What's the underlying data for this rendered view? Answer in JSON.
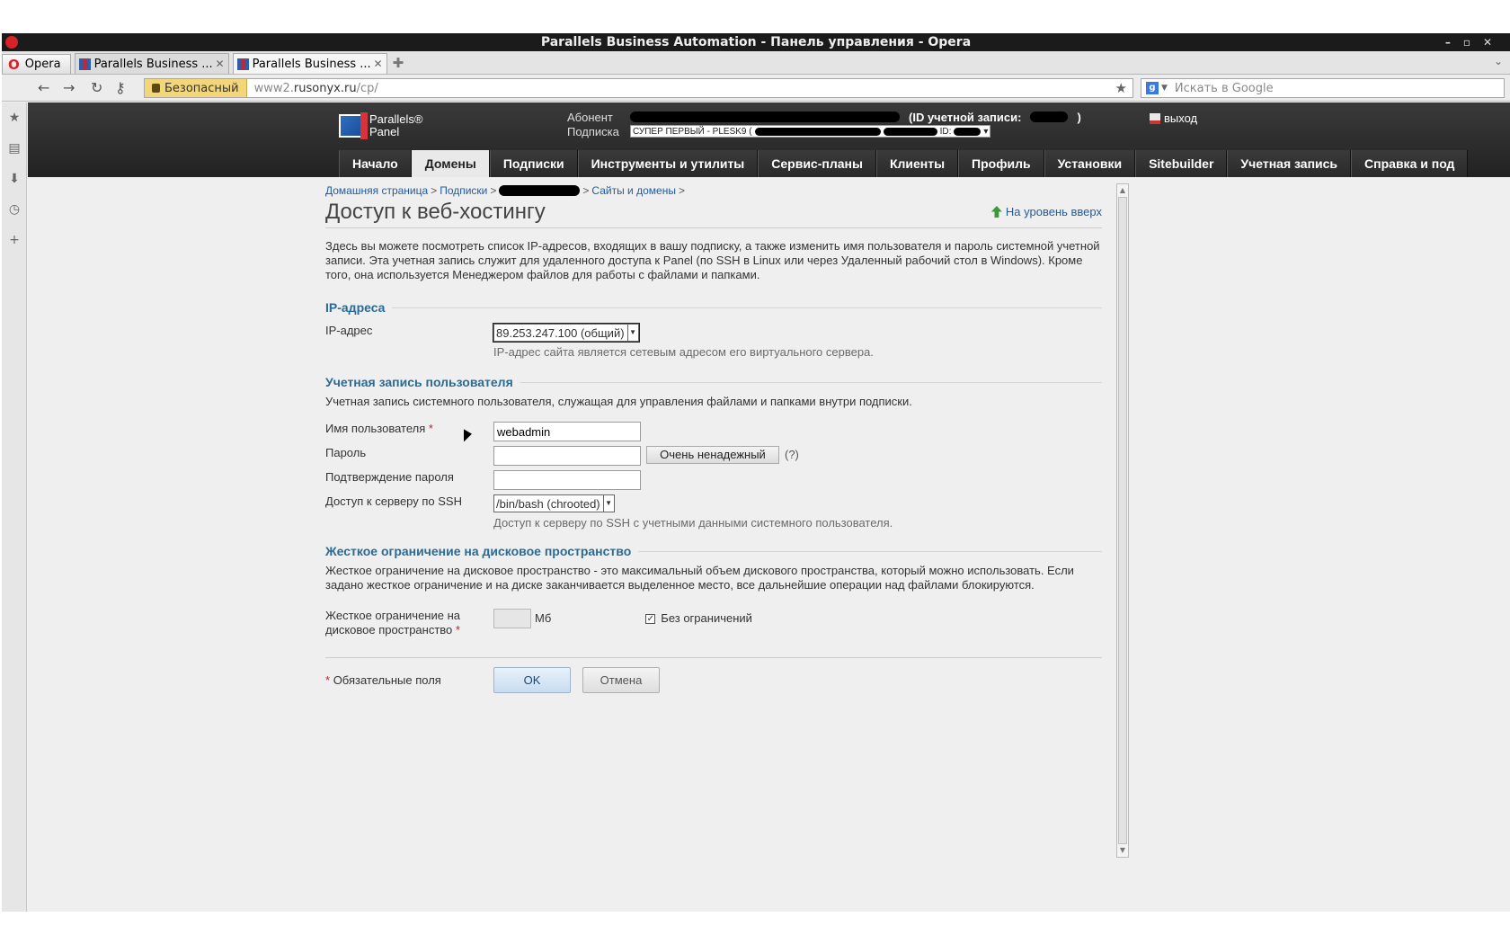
{
  "window": {
    "title": "Parallels Business Automation - Панель управления - Opera"
  },
  "tabs": {
    "opera_label": "Opera",
    "items": [
      {
        "label": "Parallels Business ..."
      },
      {
        "label": "Parallels Business ..."
      }
    ]
  },
  "addressbar": {
    "secure_label": "Безопасный",
    "url_prefix": "www2.",
    "url_host": "rusonyx.ru",
    "url_path": "/cp/",
    "search_placeholder": "Искать в Google"
  },
  "header": {
    "logo_line1": "Parallels®",
    "logo_line2": "Panel",
    "subscriber_label": "Абонент",
    "account_id_label": "(ID учетной записи:",
    "account_id_close": ")",
    "subscription_label": "Подписка",
    "subscription_value": "СУПЕР ПЕРВЫЙ - PLESK9 (",
    "subscription_id": "ID:",
    "logout": "выход"
  },
  "nav": {
    "items": [
      "Начало",
      "Домены",
      "Подписки",
      "Инструменты и утилиты",
      "Сервис-планы",
      "Клиенты",
      "Профиль",
      "Установки",
      "Sitebuilder",
      "Учетная запись",
      "Справка и под"
    ],
    "active": "Домены"
  },
  "breadcrumbs": {
    "home": "Домашняя страница",
    "subscriptions": "Подписки",
    "sites": "Сайты и домены",
    "sep": ">"
  },
  "page": {
    "title": "Доступ к веб-хостингу",
    "up_level": "На уровень вверх",
    "intro": "Здесь вы можете посмотреть список IP-адресов, входящих в вашу подписку, а также изменить имя пользователя и пароль системной учетной записи. Эта учетная запись служит для удаленного доступа к Panel (по SSH в Linux или через Удаленный рабочий стол в Windows). Кроме того, она используется Менеджером файлов для работы с файлами и папками."
  },
  "ip_section": {
    "title": "IP-адреса",
    "label": "IP-адрес",
    "value": "89.253.247.100 (общий)",
    "hint": "IP-адрес сайта является сетевым адресом его виртуального сервера."
  },
  "user_section": {
    "title": "Учетная запись пользователя",
    "desc": "Учетная запись системного пользователя, служащая для управления файлами и папками внутри подписки.",
    "username_label": "Имя пользователя",
    "username_value": "webadmin",
    "password_label": "Пароль",
    "password_strength": "Очень ненадежный",
    "help": "(?)",
    "confirm_label": "Подтверждение пароля",
    "ssh_label": "Доступ к серверу по SSH",
    "ssh_value": "/bin/bash (chrooted)",
    "ssh_hint": "Доступ к серверу по SSH с учетными данными системного пользователя."
  },
  "quota_section": {
    "title": "Жесткое ограничение на дисковое пространство",
    "desc": "Жесткое ограничение на дисковое пространство - это максимальный объем дискового пространства, который можно использовать. Если задано жесткое ограничение и на диске заканчивается выделенное место, все дальнейшие операции над файлами блокируются.",
    "label_line1": "Жесткое ограничение на",
    "label_line2": "дисковое пространство",
    "unit": "Мб",
    "unlimited_label": "Без ограничений",
    "unlimited_checked": true
  },
  "footer": {
    "required_note": "Обязательные поля",
    "required_mark": "*",
    "ok": "OK",
    "cancel": "Отмена"
  }
}
